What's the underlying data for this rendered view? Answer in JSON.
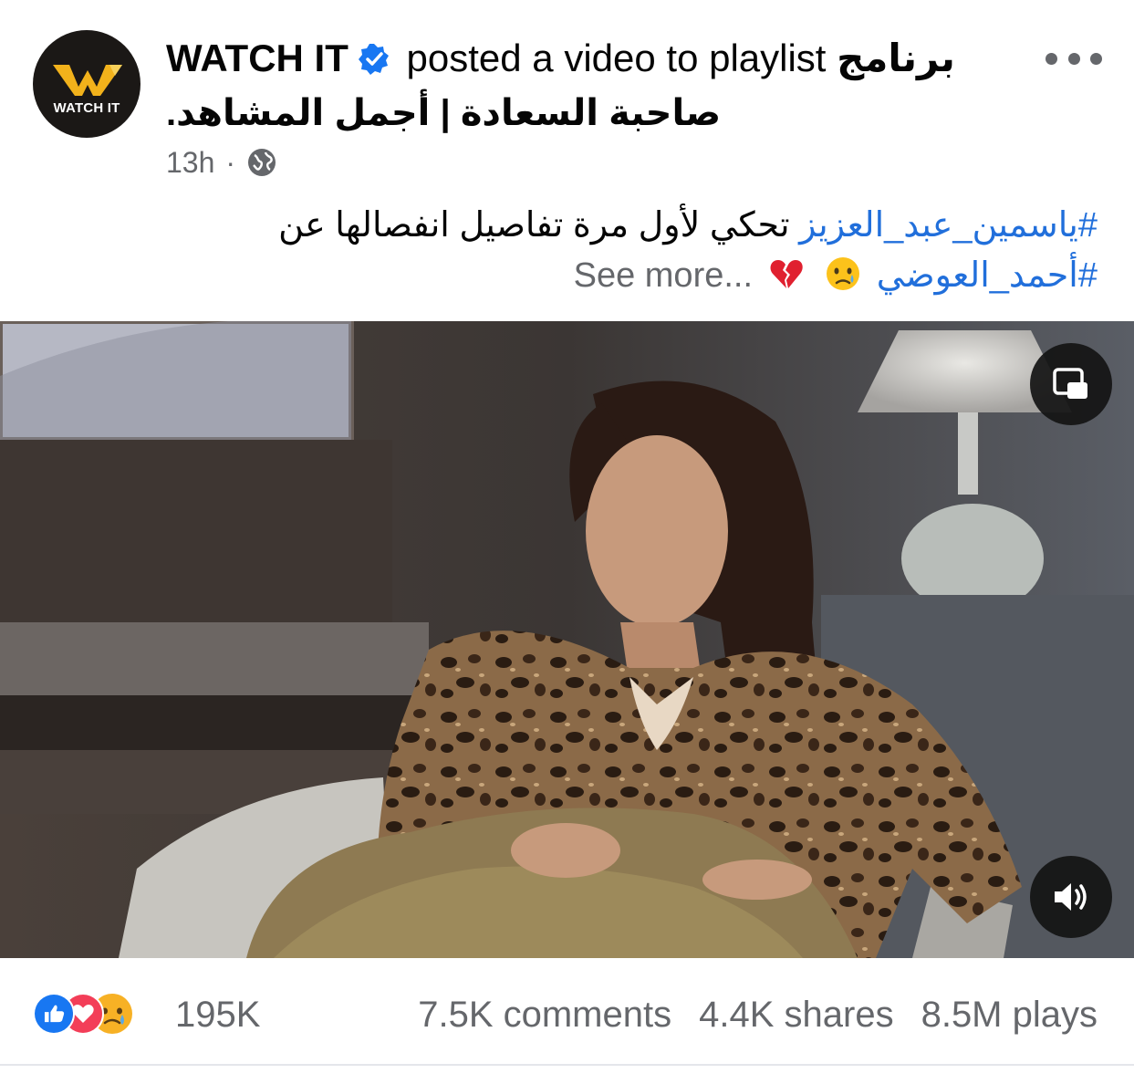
{
  "post": {
    "page_name": "WATCH IT",
    "avatar_text": "WATCH IT",
    "action_text": "posted a video to playlist",
    "playlist_part1": "برنامج",
    "playlist_part2": "صاحبة السعادة | أجمل المشاهد.",
    "time": "13h",
    "separator": "·",
    "audience_icon": "globe-icon",
    "more_icon": "more-horizontal-icon"
  },
  "caption": {
    "hashtag1": "#ياسمين_عبد_العزيز",
    "text": "تحكي لأول مرة تفاصيل انفصالها عن",
    "hashtag2": "#أحمد_العوضي",
    "emojis": [
      "crying-face-emoji",
      "broken-heart-emoji"
    ],
    "see_more": "See more..."
  },
  "video": {
    "pip_icon": "picture-in-picture-icon",
    "sound_icon": "speaker-volume-icon"
  },
  "stats": {
    "reaction_icons": [
      "like-reaction-icon",
      "love-reaction-icon",
      "sad-reaction-icon"
    ],
    "reactions_count": "195K",
    "comments": "7.5K comments",
    "shares": "4.4K shares",
    "plays": "8.5M plays"
  },
  "colors": {
    "link_blue": "#216fdb",
    "secondary_text": "#65676b",
    "verified_blue": "#1877f2",
    "brand_yellow": "#f2b21b"
  }
}
